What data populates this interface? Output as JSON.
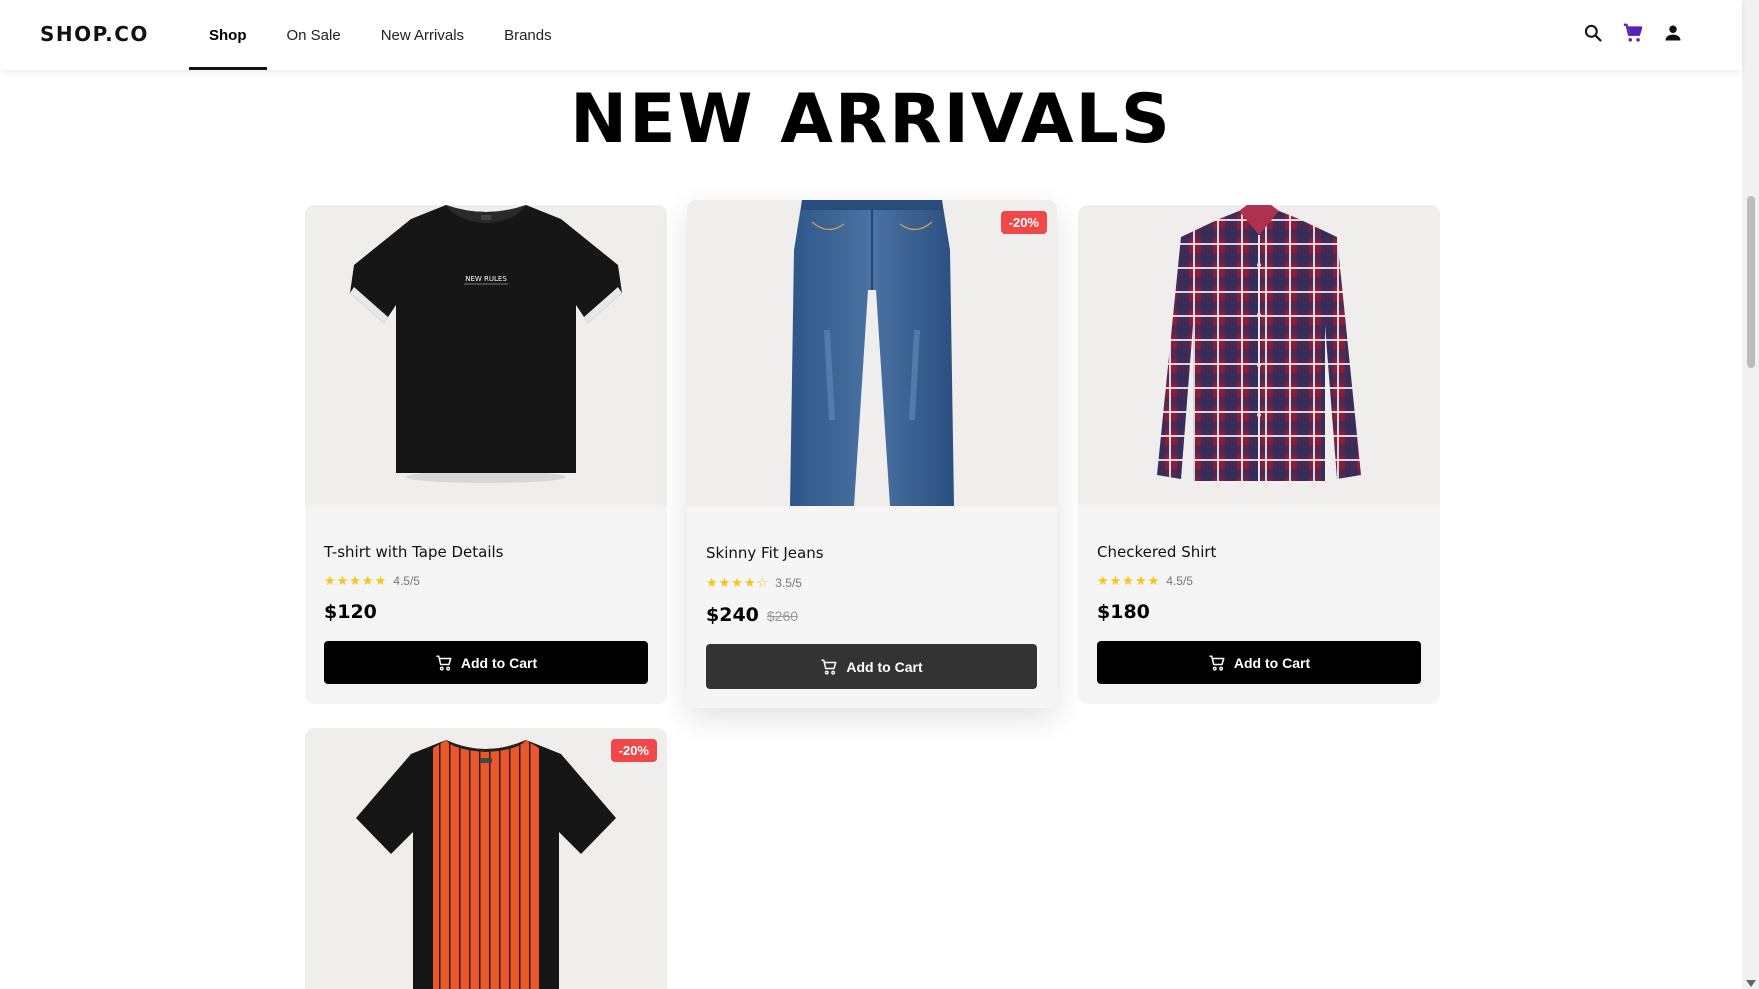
{
  "brand": "SHOP.CO",
  "nav": {
    "items": [
      {
        "label": "Shop",
        "active": true
      },
      {
        "label": "On Sale",
        "active": false
      },
      {
        "label": "New Arrivals",
        "active": false
      },
      {
        "label": "Brands",
        "active": false
      }
    ],
    "icons": [
      "search-icon",
      "cart-icon",
      "user-icon"
    ],
    "cart_icon_color": "#5b21b6"
  },
  "page_title": "NEW ARRIVALS",
  "products": [
    {
      "name": "T-shirt with Tape Details",
      "stars": "★★★★★",
      "rating": "4.5/5",
      "price": "$120",
      "old_price": "",
      "badge": "",
      "button": "Add to Cart"
    },
    {
      "name": "Skinny Fit Jeans",
      "stars": "★★★★☆",
      "rating": "3.5/5",
      "price": "$240",
      "old_price": "$260",
      "badge": "-20%",
      "button": "Add to Cart"
    },
    {
      "name": "Checkered Shirt",
      "stars": "★★★★★",
      "rating": "4.5/5",
      "price": "$180",
      "old_price": "",
      "badge": "",
      "button": "Add to Cart"
    },
    {
      "name": "",
      "stars": "",
      "rating": "",
      "price": "",
      "old_price": "",
      "badge": "-20%",
      "button": ""
    }
  ],
  "colors": {
    "badge": "#f04848",
    "star": "#f5c518",
    "button": "#000000",
    "button_hover": "#333333"
  }
}
